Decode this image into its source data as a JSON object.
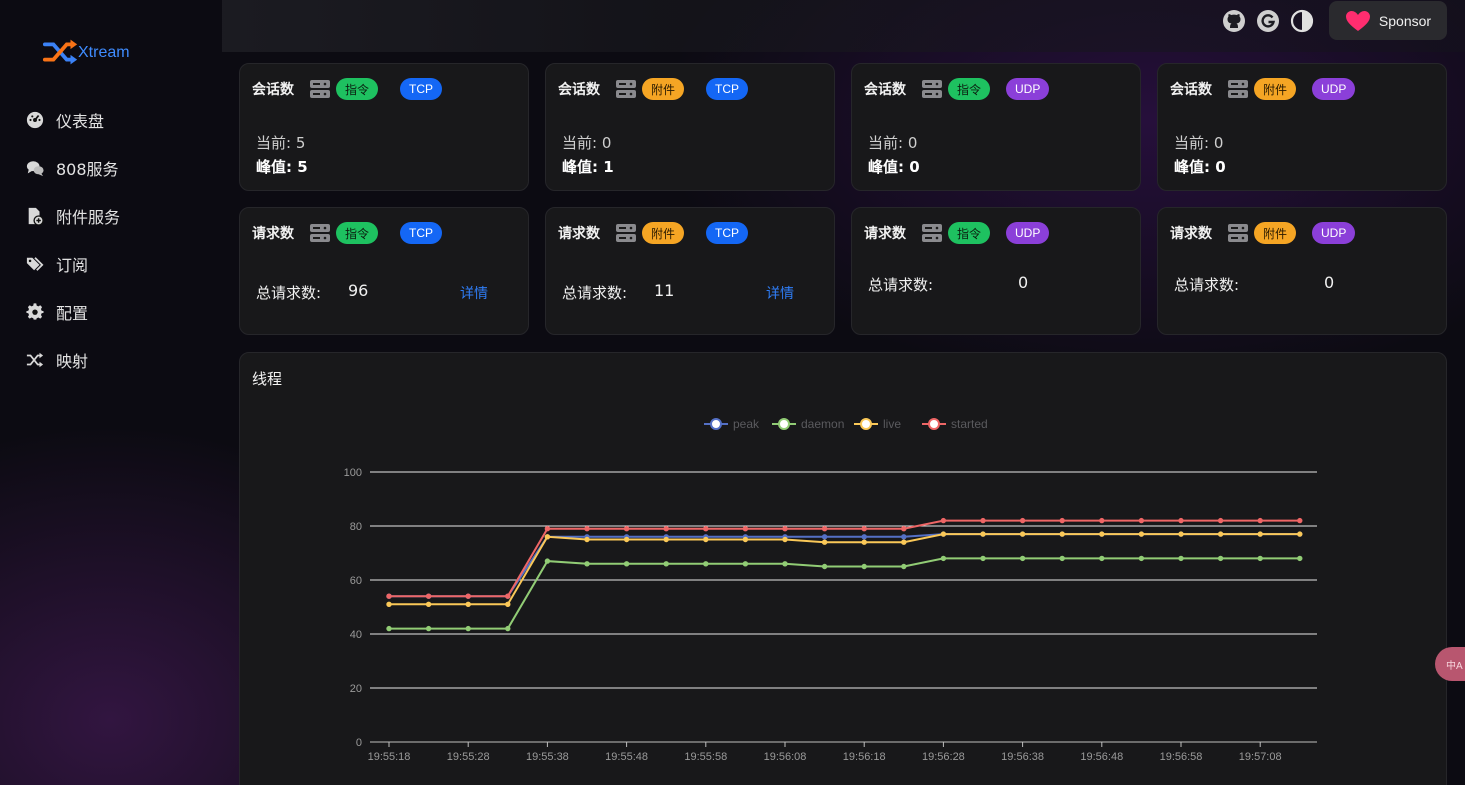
{
  "app": {
    "logo_text": "Xtream"
  },
  "sidebar": {
    "items": [
      {
        "label": "仪表盘",
        "icon": "dashboard-icon"
      },
      {
        "label": "808服务",
        "icon": "chat-icon"
      },
      {
        "label": "附件服务",
        "icon": "file-add-icon"
      },
      {
        "label": "订阅",
        "icon": "tags-icon"
      },
      {
        "label": "配置",
        "icon": "gear-icon"
      },
      {
        "label": "映射",
        "icon": "shuffle-icon"
      }
    ]
  },
  "topbar": {
    "icons": [
      "github-icon",
      "g-circle-icon",
      "theme-toggle-icon"
    ],
    "sponsor_label": "Sponsor",
    "colors": {
      "heart": "#ff2d6f"
    }
  },
  "session_cards": [
    {
      "title": "会话数",
      "tag1": "指令",
      "tag2": "TCP",
      "current": "当前: 5",
      "peak": "峰值: 5"
    },
    {
      "title": "会话数",
      "tag1": "附件",
      "tag2": "TCP",
      "current": "当前: 0",
      "peak": "峰值: 1"
    },
    {
      "title": "会话数",
      "tag1": "指令",
      "tag2": "UDP",
      "current": "当前: 0",
      "peak": "峰值: 0"
    },
    {
      "title": "会话数",
      "tag1": "附件",
      "tag2": "UDP",
      "current": "当前: 0",
      "peak": "峰值: 0"
    }
  ],
  "request_cards": [
    {
      "title": "请求数",
      "tag1": "指令",
      "tag2": "TCP",
      "label": "总请求数:",
      "value": "96",
      "link": "详情"
    },
    {
      "title": "请求数",
      "tag1": "附件",
      "tag2": "TCP",
      "label": "总请求数:",
      "value": "11",
      "link": "详情"
    },
    {
      "title": "请求数",
      "tag1": "指令",
      "tag2": "UDP",
      "label": "总请求数:",
      "value": "0",
      "link": ""
    },
    {
      "title": "请求数",
      "tag1": "附件",
      "tag2": "UDP",
      "label": "总请求数:",
      "value": "0",
      "link": ""
    }
  ],
  "tag_colors": {
    "指令": "#1ec160",
    "附件": "#f5a524",
    "TCP": "#1467f5",
    "UDP": "#8b3fd9"
  },
  "chart": {
    "title": "线程"
  },
  "translate_button": {
    "label": "中A"
  },
  "chart_data": {
    "type": "line",
    "title": "线程",
    "legend_position": "top-center",
    "grid": true,
    "ylim": [
      0,
      100
    ],
    "yticks": [
      0,
      20,
      40,
      60,
      80,
      100
    ],
    "x": [
      "19:55:18",
      "19:55:23",
      "19:55:28",
      "19:55:33",
      "19:55:38",
      "19:55:43",
      "19:55:48",
      "19:55:53",
      "19:55:58",
      "19:56:03",
      "19:56:08",
      "19:56:13",
      "19:56:18",
      "19:56:23",
      "19:56:28",
      "19:56:33",
      "19:56:38",
      "19:56:43",
      "19:56:48",
      "19:56:53",
      "19:56:58",
      "19:57:03",
      "19:57:08",
      "19:57:13"
    ],
    "xticks": [
      "19:55:18",
      "19:55:28",
      "19:55:38",
      "19:55:48",
      "19:55:58",
      "19:56:08",
      "19:56:18",
      "19:56:28",
      "19:56:38",
      "19:56:48",
      "19:56:58",
      "19:57:08"
    ],
    "series": [
      {
        "name": "peak",
        "color": "#5470c6",
        "values": [
          54,
          54,
          54,
          54,
          76,
          76,
          76,
          76,
          76,
          76,
          76,
          76,
          76,
          76,
          77,
          77,
          77,
          77,
          77,
          77,
          77,
          77,
          77,
          77
        ]
      },
      {
        "name": "daemon",
        "color": "#91cc75",
        "values": [
          42,
          42,
          42,
          42,
          67,
          66,
          66,
          66,
          66,
          66,
          66,
          65,
          65,
          65,
          68,
          68,
          68,
          68,
          68,
          68,
          68,
          68,
          68,
          68
        ]
      },
      {
        "name": "live",
        "color": "#fac858",
        "values": [
          51,
          51,
          51,
          51,
          76,
          75,
          75,
          75,
          75,
          75,
          75,
          74,
          74,
          74,
          77,
          77,
          77,
          77,
          77,
          77,
          77,
          77,
          77,
          77
        ]
      },
      {
        "name": "started",
        "color": "#ee6666",
        "values": [
          54,
          54,
          54,
          54,
          79,
          79,
          79,
          79,
          79,
          79,
          79,
          79,
          79,
          79,
          82,
          82,
          82,
          82,
          82,
          82,
          82,
          82,
          82,
          82
        ]
      }
    ]
  }
}
